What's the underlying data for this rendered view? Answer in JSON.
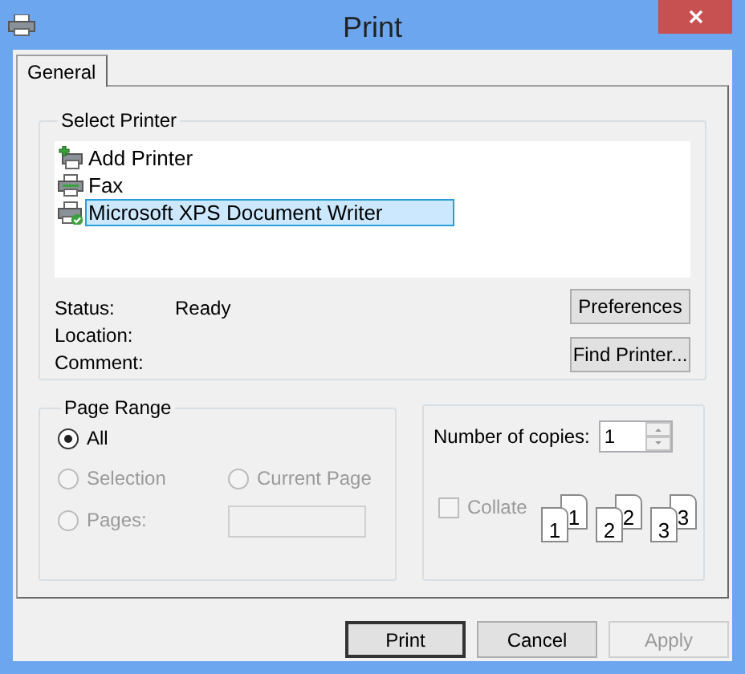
{
  "window": {
    "title": "Print"
  },
  "tabs": [
    {
      "label": "General",
      "selected": true
    }
  ],
  "select_printer": {
    "title": "Select Printer",
    "printers": [
      {
        "name": "Add Printer",
        "kind": "add",
        "selected": false
      },
      {
        "name": "Fax",
        "kind": "fax",
        "selected": false
      },
      {
        "name": "Microsoft XPS Document Writer",
        "kind": "default",
        "selected": true
      }
    ],
    "info": [
      {
        "label": "Status:",
        "value": "Ready"
      },
      {
        "label": "Location:"
      },
      {
        "label": "Comment:"
      }
    ],
    "buttons": [
      "Preferences",
      "Find Printer..."
    ]
  },
  "page_range": {
    "title": "Page Range",
    "options": [
      {
        "label": "All",
        "selected": true,
        "disabled": false
      },
      {
        "label": "Selection",
        "selected": false,
        "disabled": true
      },
      {
        "label": "Current Page",
        "selected": false,
        "disabled": true
      },
      {
        "label": "Pages:",
        "selected": false,
        "disabled": true
      }
    ],
    "pages_field": {
      "disabled": true
    }
  },
  "copies": {
    "label": "Number of copies:",
    "value": "1",
    "collate": {
      "label": "Collate",
      "checked": false,
      "disabled": true
    },
    "collate_pages": [
      {
        "back": "1",
        "front": "1"
      },
      {
        "back": "2",
        "front": "2"
      },
      {
        "back": "3",
        "front": "3"
      }
    ]
  },
  "buttons": [
    {
      "label": "Print",
      "disabled": false,
      "default": true
    },
    {
      "label": "Cancel",
      "disabled": false,
      "default": false
    },
    {
      "label": "Apply",
      "disabled": true,
      "default": false
    }
  ]
}
